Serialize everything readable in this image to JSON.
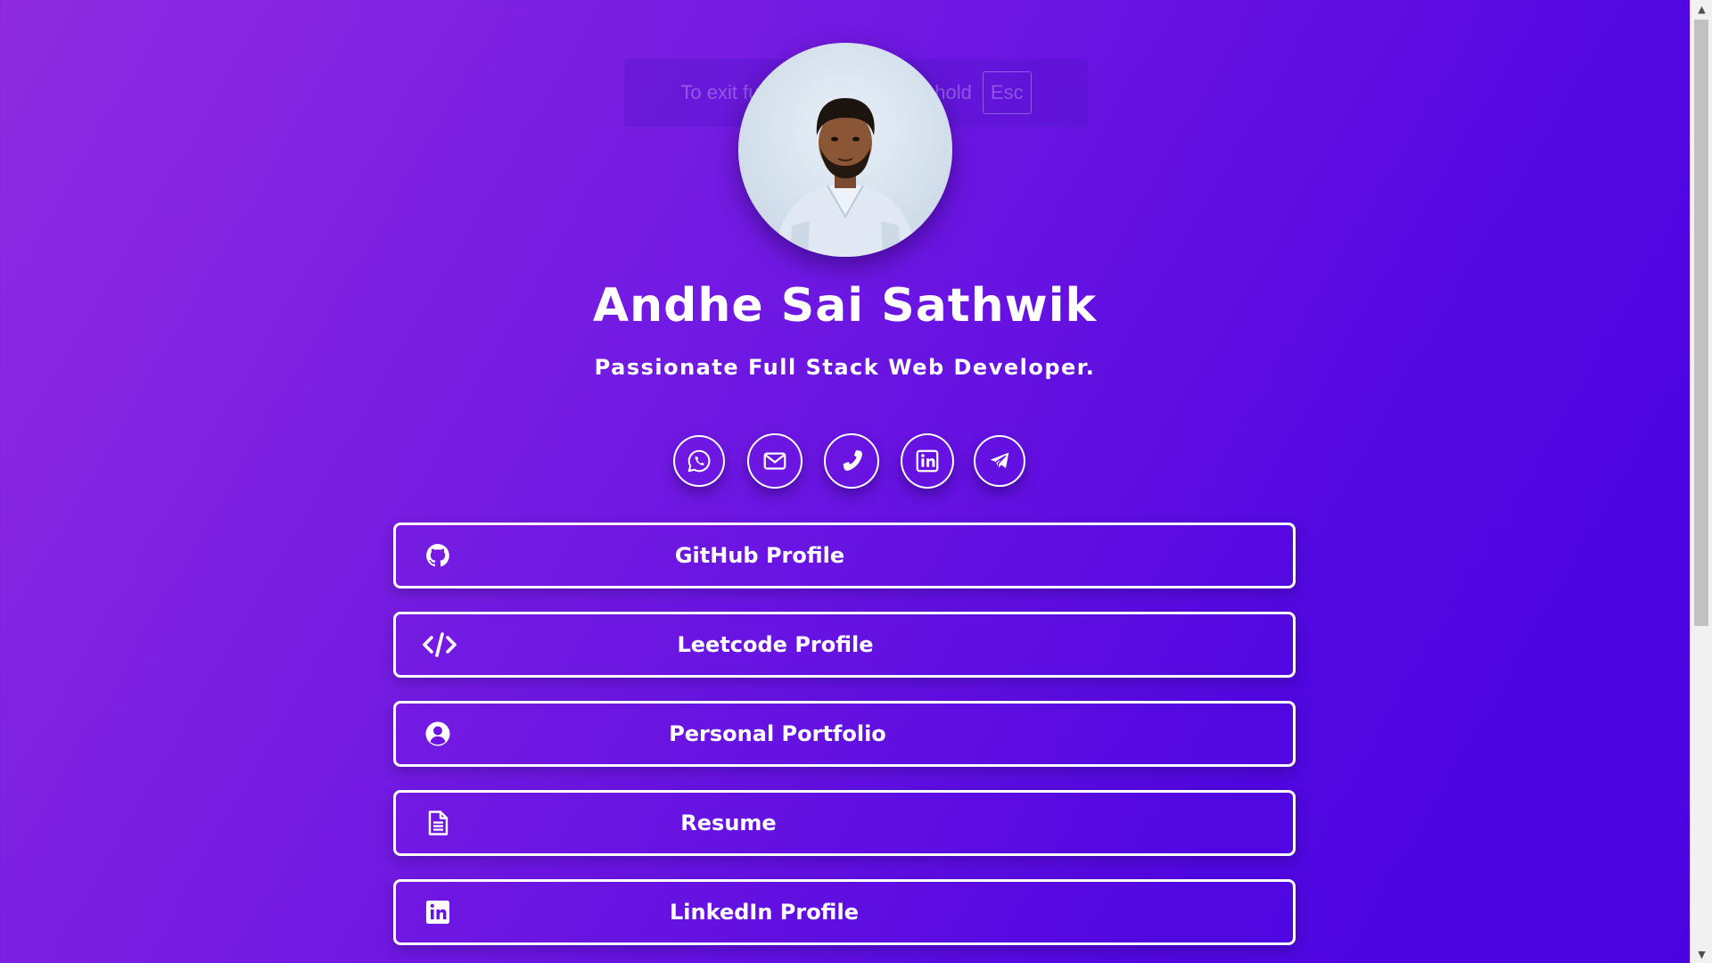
{
  "overlay": {
    "message": "To exit full screen, press and hold",
    "key": "Esc"
  },
  "profile": {
    "name": "Andhe Sai Sathwik",
    "tagline": "Passionate Full Stack Web Developer."
  },
  "socials": [
    {
      "icon": "whatsapp-icon"
    },
    {
      "icon": "mail-icon"
    },
    {
      "icon": "phone-icon"
    },
    {
      "icon": "linkedin-icon"
    },
    {
      "icon": "telegram-icon"
    }
  ],
  "links": [
    {
      "label": "GitHub Profile",
      "icon": "github-icon"
    },
    {
      "label": "Leetcode Profile",
      "icon": "code-icon"
    },
    {
      "label": "Personal Portfolio",
      "icon": "user-circle-icon"
    },
    {
      "label": "Resume",
      "icon": "document-icon"
    },
    {
      "label": "LinkedIn Profile",
      "icon": "linkedin-icon"
    }
  ],
  "colors": {
    "gradient_start": "#8e2be0",
    "gradient_end": "#4a05df",
    "foreground": "#ffffff"
  }
}
